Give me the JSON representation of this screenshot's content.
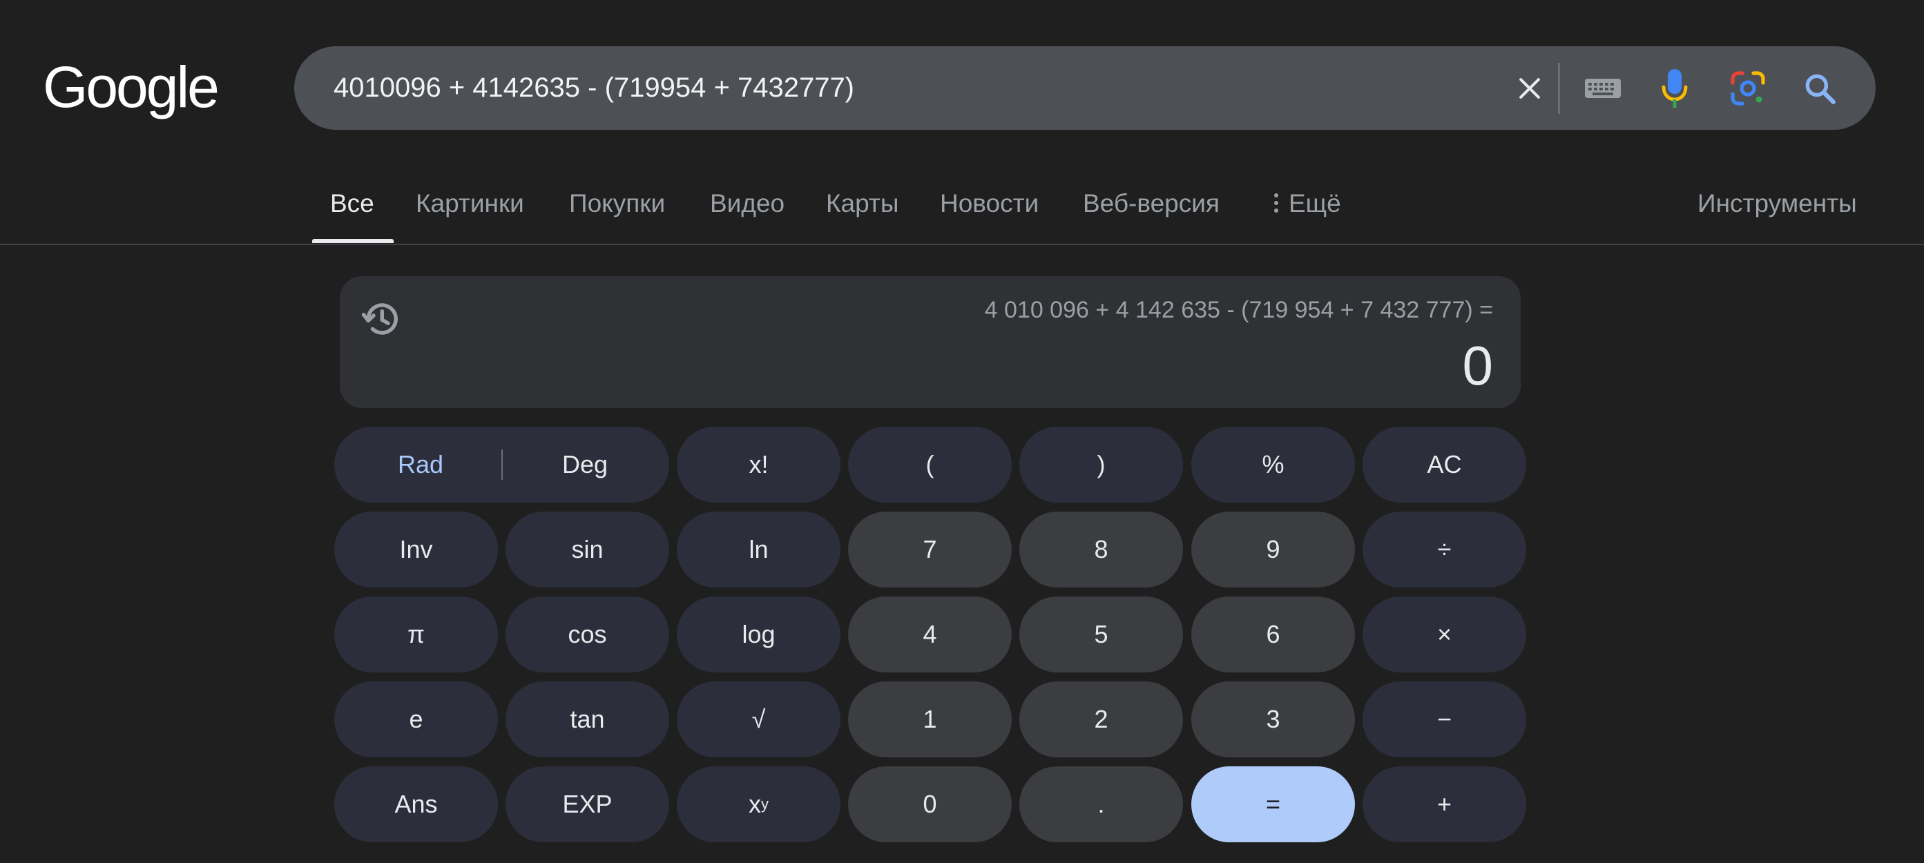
{
  "logo": "Google",
  "search": {
    "query": "4010096 + 4142635 - (719954 + 7432777)"
  },
  "tabs": [
    {
      "label": "Все",
      "active": true
    },
    {
      "label": "Картинки"
    },
    {
      "label": "Покупки"
    },
    {
      "label": "Видео"
    },
    {
      "label": "Карты"
    },
    {
      "label": "Новости"
    },
    {
      "label": "Веб-версия"
    },
    {
      "label": "Ещё"
    }
  ],
  "tools_label": "Инструменты",
  "calculator": {
    "expression": "4 010 096 + 4 142 635 - (719 954 + 7 432 777) =",
    "result": "0",
    "rad": "Rad",
    "deg": "Deg",
    "keys": {
      "fact": "x!",
      "lparen": "(",
      "rparen": ")",
      "percent": "%",
      "ac": "AC",
      "inv": "Inv",
      "sin": "sin",
      "ln": "ln",
      "k7": "7",
      "k8": "8",
      "k9": "9",
      "div": "÷",
      "pi": "π",
      "cos": "cos",
      "log": "log",
      "k4": "4",
      "k5": "5",
      "k6": "6",
      "mul": "×",
      "e": "e",
      "tan": "tan",
      "sqrt": "√",
      "k1": "1",
      "k2": "2",
      "k3": "3",
      "minus": "−",
      "ans": "Ans",
      "exp": "EXP",
      "pow_base": "x",
      "pow_sup": "y",
      "k0": "0",
      "dot": ".",
      "eq": "=",
      "plus": "+"
    }
  },
  "colors": {
    "rad_active": "#a8c7fa",
    "equals_bg": "#aecbfa",
    "mic_blue": "#4285f4",
    "mic_yellow": "#fbbc04"
  }
}
